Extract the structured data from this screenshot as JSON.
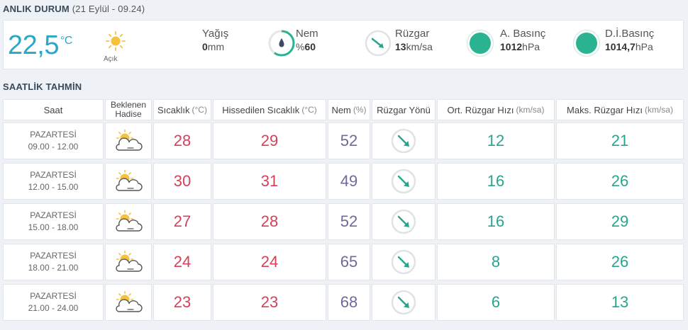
{
  "current": {
    "title": "ANLIK DURUM",
    "datetime": "(21 Eylül - 09.24)",
    "temperature": "22,5",
    "temp_unit": "°C",
    "condition": "Açık",
    "condition_icon": "sun-icon",
    "rain_label": "Yağış",
    "rain_value": "0",
    "rain_unit": "mm",
    "humidity_label": "Nem",
    "humidity_prefix": "%",
    "humidity_value": "60",
    "wind_label": "Rüzgar",
    "wind_value": "13",
    "wind_unit": "km/sa",
    "pressure_label": "A. Basınç",
    "pressure_value": "1012",
    "pressure_unit": "hPa",
    "sea_pressure_label": "D.İ.Basınç",
    "sea_pressure_value": "1014,7",
    "sea_pressure_unit": "hPa",
    "colors": {
      "accent": "#2aa7c9",
      "teal": "#2ab391",
      "temp_red": "#d3415a",
      "humidity_purple": "#6e6a9a"
    }
  },
  "hourly": {
    "title": "SAATLİK TAHMİN",
    "headers": {
      "time": "Saat",
      "event_line1": "Beklenen",
      "event_line2": "Hadise",
      "temp": "Sıcaklık",
      "temp_unit": "(°C)",
      "feels": "Hissedilen Sıcaklık",
      "feels_unit": "(°C)",
      "humidity": "Nem",
      "humidity_unit": "(%)",
      "wind_dir": "Rüzgar Yönü",
      "avg_wind": "Ort. Rüzgar Hızı",
      "avg_wind_unit": "(km/sa)",
      "max_wind": "Maks. Rüzgar Hızı",
      "max_wind_unit": "(km/sa)"
    },
    "rows": [
      {
        "day": "PAZARTESİ",
        "range": "09.00 - 12.00",
        "icon": "partly-cloudy-icon",
        "temp": "28",
        "feels": "29",
        "humidity": "52",
        "avg_wind": "12",
        "max_wind": "21"
      },
      {
        "day": "PAZARTESİ",
        "range": "12.00 - 15.00",
        "icon": "partly-cloudy-icon",
        "temp": "30",
        "feels": "31",
        "humidity": "49",
        "avg_wind": "16",
        "max_wind": "26"
      },
      {
        "day": "PAZARTESİ",
        "range": "15.00 - 18.00",
        "icon": "partly-cloudy-icon",
        "temp": "27",
        "feels": "28",
        "humidity": "52",
        "avg_wind": "16",
        "max_wind": "29"
      },
      {
        "day": "PAZARTESİ",
        "range": "18.00 - 21.00",
        "icon": "partly-cloudy-icon",
        "temp": "24",
        "feels": "24",
        "humidity": "65",
        "avg_wind": "8",
        "max_wind": "26"
      },
      {
        "day": "PAZARTESİ",
        "range": "21.00 - 24.00",
        "icon": "partly-cloudy-icon",
        "temp": "23",
        "feels": "23",
        "humidity": "68",
        "avg_wind": "6",
        "max_wind": "13"
      }
    ]
  }
}
